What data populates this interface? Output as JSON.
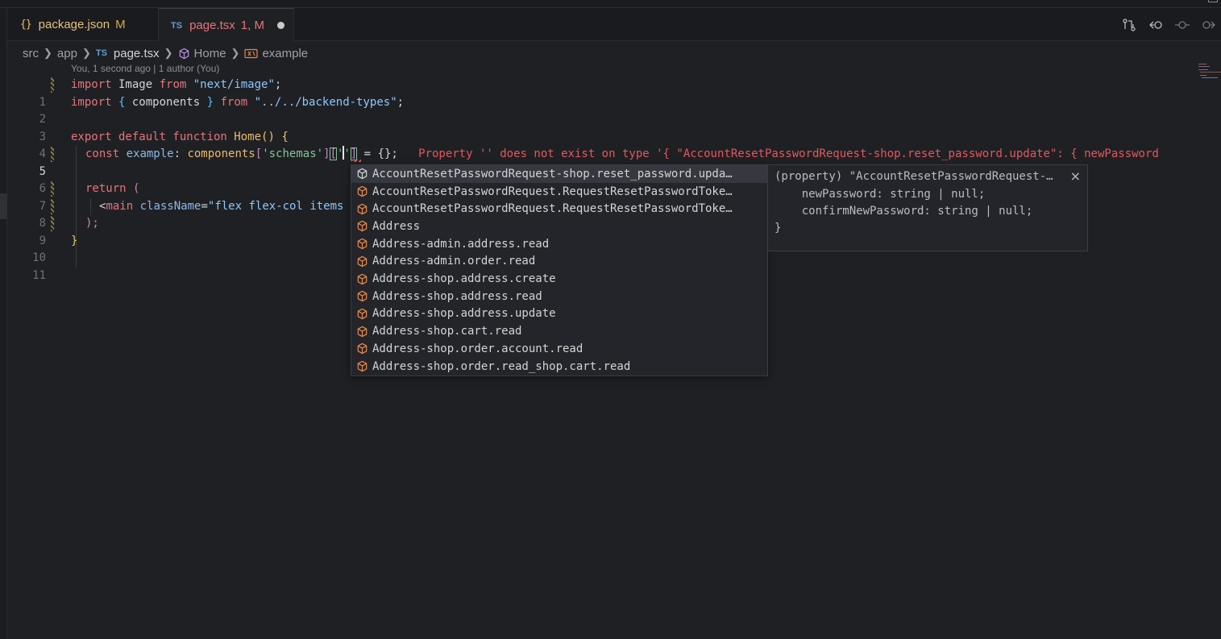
{
  "tabs": [
    {
      "icon": "{}",
      "name": "package.json",
      "status": "M"
    },
    {
      "icon": "TS",
      "name": "page.tsx",
      "status": "1, M",
      "dirty": true
    }
  ],
  "breadcrumb": {
    "items": [
      "src",
      "app",
      "page.tsx",
      "Home",
      "example"
    ],
    "ts_badge": "TS"
  },
  "blame_hint": "You, 1 second ago | 1 author (You)",
  "code": {
    "line_numbers": [
      "1",
      "2",
      "3",
      "4",
      "5",
      "6",
      "7",
      "8",
      "9",
      "10",
      "11"
    ],
    "l1": {
      "kw1": "import",
      "id": " Image ",
      "kw2": "from",
      "str": " \"next/image\"",
      "end": ";"
    },
    "l2": {
      "kw1": "import",
      "b1": " { ",
      "id": "components",
      "b2": " } ",
      "kw2": "from",
      "str": " \"../../backend-types\"",
      "end": ";"
    },
    "l4": {
      "kw": "export default function",
      "fn": " Home",
      "paren": "()",
      "brace": " {"
    },
    "l5": {
      "kw": "const",
      "var": " example",
      "colon": ": ",
      "type": "components",
      "sq1": "[",
      "s1": "'schemas'",
      "sq2": "]",
      "sq3": "[",
      "q1": "'",
      "q2": "'",
      "sq4": "]",
      "rest": " = {};",
      "error": "Property '' does not exist on type '{ \"AccountResetPasswordRequest-shop.reset_password.update\": { newPassword"
    },
    "l7": {
      "kw": "return",
      "paren": " ("
    },
    "l8": {
      "lt": "<",
      "tag": "main",
      "attr": " className",
      "eq": "=",
      "str": "\"flex flex-col items"
    },
    "l9": {
      "paren": ");"
    },
    "l10": {
      "brace": "}"
    }
  },
  "suggest": {
    "items": [
      "AccountResetPasswordRequest-shop.reset_password.update",
      "AccountResetPasswordRequest.RequestResetPasswordToken",
      "AccountResetPasswordRequest.RequestResetPasswordToken",
      "Address",
      "Address-admin.address.read",
      "Address-admin.order.read",
      "Address-shop.address.create",
      "Address-shop.address.read",
      "Address-shop.address.update",
      "Address-shop.cart.read",
      "Address-shop.order.account.read",
      "Address-shop.order.read_shop.cart.read"
    ],
    "display": [
      "AccountResetPasswordRequest-shop.reset_password.upda…",
      "AccountResetPasswordRequest.RequestResetPasswordToke…",
      "AccountResetPasswordRequest.RequestResetPasswordToke…",
      "Address",
      "Address-admin.address.read",
      "Address-admin.order.read",
      "Address-shop.address.create",
      "Address-shop.address.read",
      "Address-shop.address.update",
      "Address-shop.cart.read",
      "Address-shop.order.account.read",
      "Address-shop.order.read_shop.cart.read"
    ],
    "selected_index": 0
  },
  "details": {
    "lines": [
      "(property) \"AccountResetPasswordRequest-…",
      "    newPassword: string | null;",
      "    confirmNewPassword: string | null;",
      "}"
    ],
    "close": "×"
  },
  "colors": {
    "editor_bg": "#1f2024",
    "keyword": "#e5747a",
    "string": "#8cc8ff",
    "function": "#e9b96e",
    "error": "#e5575c",
    "suggest_icon": "#e8884a"
  }
}
